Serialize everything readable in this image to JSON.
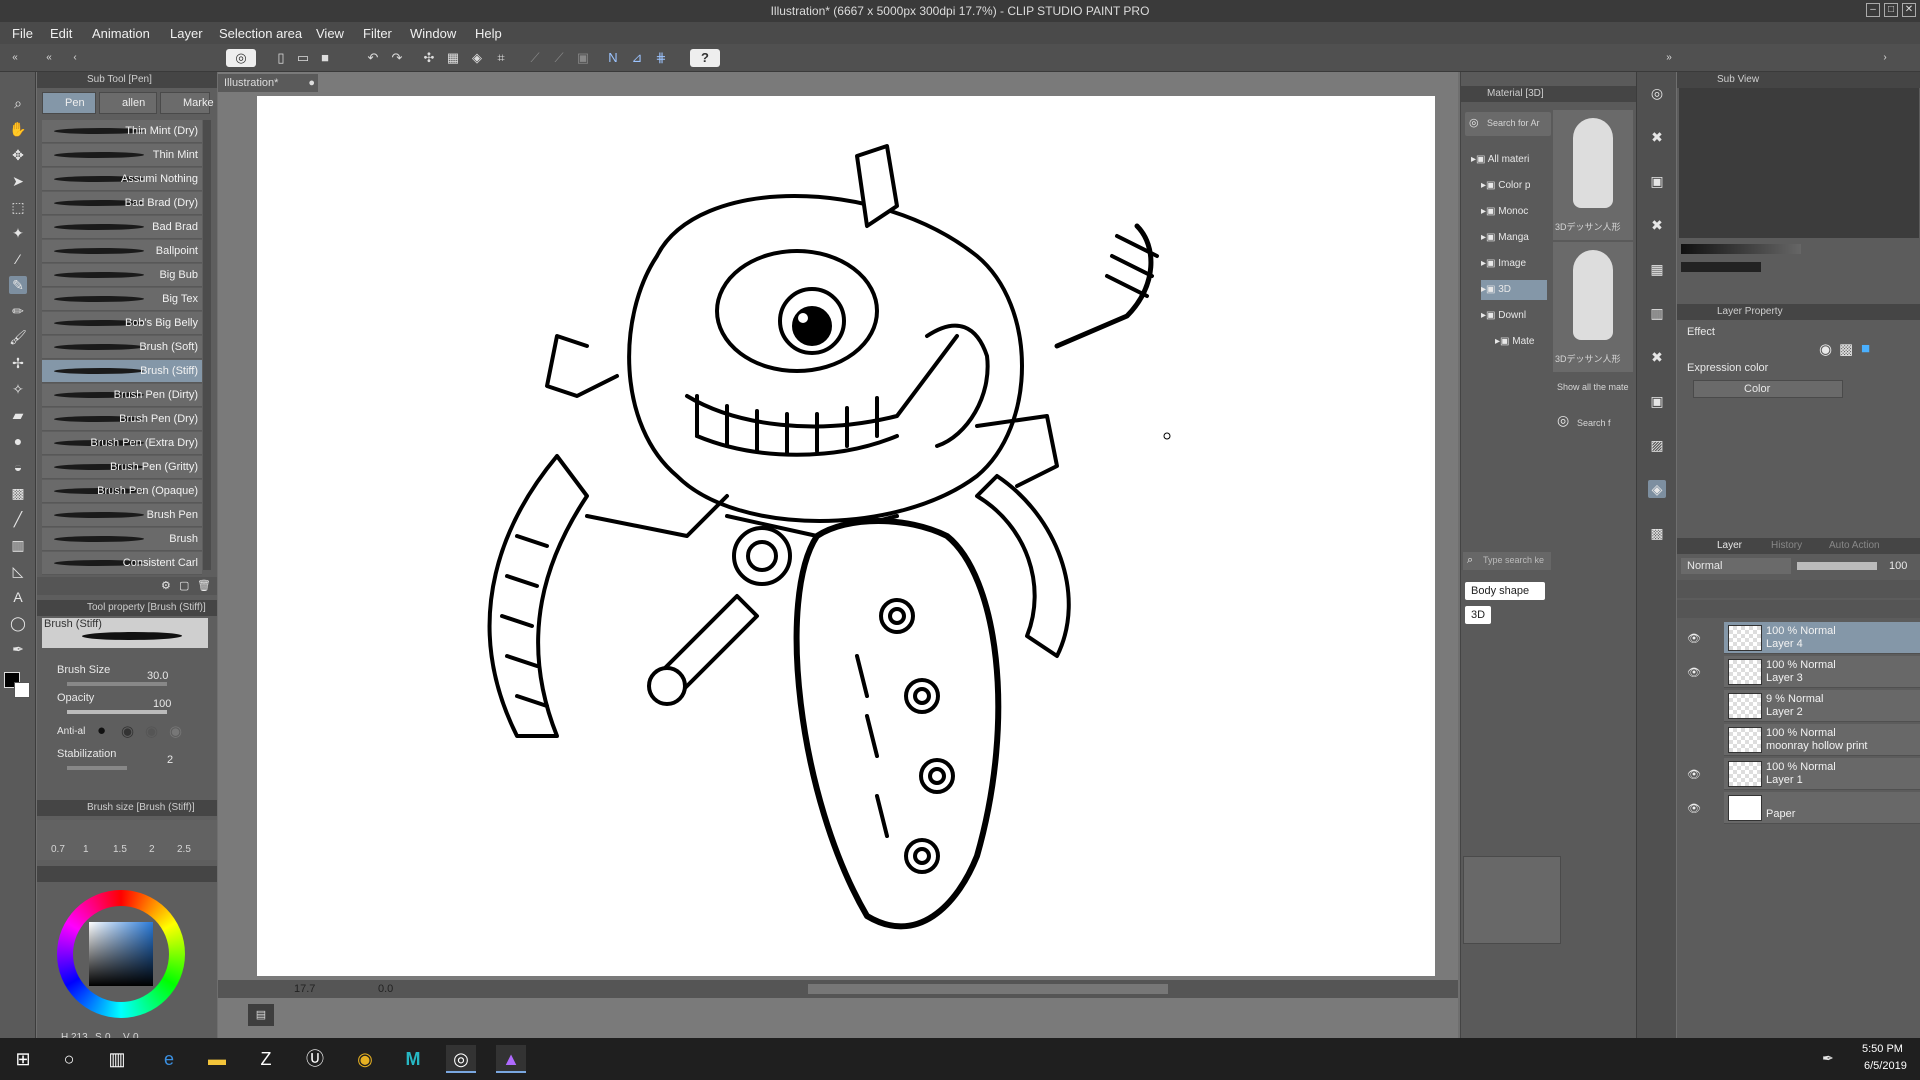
{
  "window": {
    "title": "Illustration* (6667 x 5000px 300dpi 17.7%) - CLIP STUDIO PAINT PRO",
    "controls": [
      "–",
      "□",
      "✕"
    ]
  },
  "menu": [
    "File",
    "Edit",
    "Animation",
    "Layer",
    "Selection area",
    "View",
    "Filter",
    "Window",
    "Help"
  ],
  "toolbar": {
    "help_label": "?"
  },
  "document": {
    "tab": "Illustration*",
    "zoom": "17.7",
    "rotation": "0.0"
  },
  "subtool": {
    "header": "Sub Tool [Pen]",
    "tabs": [
      "Pen",
      "allen",
      "Marke"
    ],
    "brushes": [
      "Thin Mint (Dry)",
      "Thin Mint",
      "Assumi Nothing",
      "Bad Brad (Dry)",
      "Bad Brad",
      "Ballpoint",
      "Big Bub",
      "Big Tex",
      "Bob's Big Belly",
      "Brush (Soft)",
      "Brush (Stiff)",
      "Brush Pen (Dirty)",
      "Brush Pen (Dry)",
      "Brush Pen (Extra Dry)",
      "Brush Pen (Gritty)",
      "Brush Pen (Opaque)",
      "Brush Pen",
      "Brush",
      "Consistent Carl"
    ],
    "selected_index": 10
  },
  "tool_property": {
    "header": "Tool property [Brush (Stiff)]",
    "brush_name": "Brush (Stiff)",
    "brush_size_label": "Brush Size",
    "brush_size": "30.0",
    "opacity_label": "Opacity",
    "opacity": "100",
    "antialias_label": "Anti-al",
    "stabilization_label": "Stabilization",
    "stabilization": "2"
  },
  "brush_size_panel": {
    "header": "Brush size [Brush (Stiff)]",
    "sizes": [
      "0.7",
      "1",
      "1.5",
      "2",
      "2.5"
    ]
  },
  "color": {
    "h": "213",
    "s": "0",
    "v": "0",
    "h_label": "H",
    "s_label": "S",
    "v_label": "V",
    "main": "#000000",
    "sub": "#ffffff"
  },
  "material": {
    "header": "Material [3D]",
    "search": "Search for Ar",
    "tree": [
      "All materi",
      "Color p",
      "Monoc",
      "Manga",
      "Image",
      "3D",
      "Downl",
      "Mate"
    ],
    "thumb_labels": [
      "3Dデッサン人形",
      "3Dデッサン人形"
    ],
    "show_all": "Show all the mate",
    "search2": "Search f",
    "tag_search": "Type search ke",
    "tags": [
      "Body shape",
      "3D"
    ]
  },
  "subview": {
    "header": "Sub View"
  },
  "layer_property": {
    "header": "Layer Property",
    "effect_label": "Effect",
    "expression_label": "Expression color",
    "expression_value": "Color"
  },
  "layers_panel": {
    "tabs": [
      "Layer",
      "History",
      "Auto Action"
    ],
    "blend": "Normal",
    "opacity": "100",
    "layers": [
      {
        "line1": "100 % Normal",
        "line2": "Layer 4",
        "visible": true,
        "selected": true
      },
      {
        "line1": "100 % Normal",
        "line2": "Layer 3",
        "visible": true,
        "selected": false
      },
      {
        "line1": "9 % Normal",
        "line2": "Layer 2",
        "visible": false,
        "selected": false
      },
      {
        "line1": "100 % Normal",
        "line2": "moonray hollow print",
        "visible": false,
        "selected": false
      },
      {
        "line1": "100 % Normal",
        "line2": "Layer 1",
        "visible": true,
        "selected": false
      },
      {
        "line1": "",
        "line2": "Paper",
        "visible": true,
        "selected": false
      }
    ]
  },
  "taskbar": {
    "time": "5:50 PM",
    "date": "6/5/2019",
    "apps": [
      "start-icon",
      "search-icon",
      "task-view-icon",
      "edge-icon",
      "explorer-icon",
      "zbrush-icon",
      "unreal-icon",
      "chrome-icon",
      "maya-icon",
      "clip-studio-icon",
      "affinity-icon"
    ]
  }
}
